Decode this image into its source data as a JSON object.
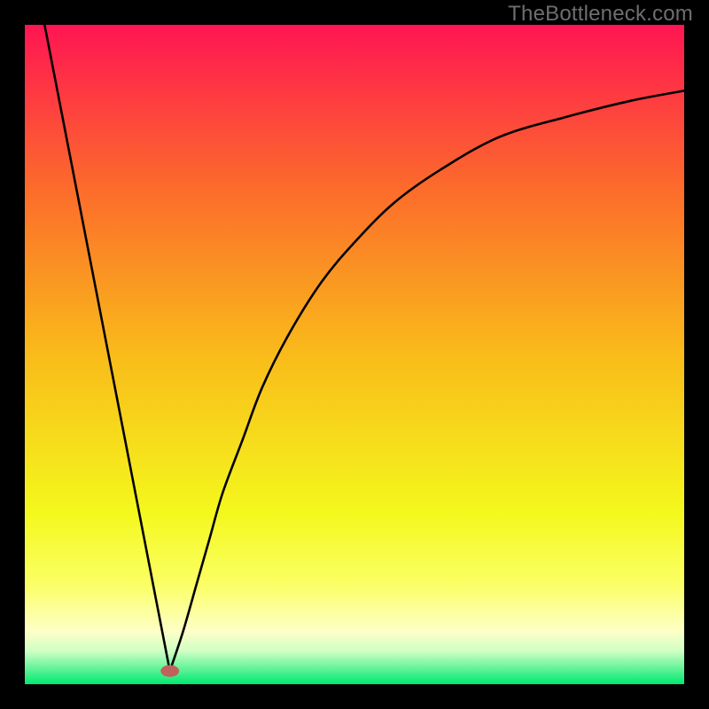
{
  "watermark": "TheBottleneck.com",
  "chart_data": {
    "type": "line",
    "title": "",
    "xlabel": "",
    "ylabel": "",
    "xlim": [
      0,
      100
    ],
    "ylim": [
      0,
      100
    ],
    "grid": false,
    "legend": false,
    "series": [
      {
        "name": "left-branch",
        "x": [
          3,
          22
        ],
        "y": [
          100,
          2
        ]
      },
      {
        "name": "right-branch",
        "x": [
          22,
          24,
          26,
          28,
          30,
          33,
          36,
          40,
          45,
          50,
          56,
          63,
          72,
          82,
          92,
          100
        ],
        "y": [
          2,
          8,
          15,
          22,
          29,
          37,
          45,
          53,
          61,
          67,
          73,
          78,
          83,
          86,
          88.5,
          90
        ]
      }
    ],
    "annotations": [
      {
        "name": "vertex-marker",
        "x": 22,
        "y": 2,
        "shape": "ellipse",
        "rx": 1.4,
        "ry": 0.9,
        "fill": "#c1615c"
      }
    ],
    "background_gradient": {
      "type": "linear-vertical",
      "stops": [
        {
          "offset": 0.0,
          "color": "#ff1552"
        },
        {
          "offset": 0.25,
          "color": "#fc6c2b"
        },
        {
          "offset": 0.5,
          "color": "#f9bb1a"
        },
        {
          "offset": 0.74,
          "color": "#f4f81d"
        },
        {
          "offset": 0.85,
          "color": "#fbff66"
        },
        {
          "offset": 0.92,
          "color": "#fdffc7"
        },
        {
          "offset": 0.95,
          "color": "#cfffc4"
        },
        {
          "offset": 1.0,
          "color": "#00e971"
        }
      ]
    },
    "line_style": {
      "color": "#000000",
      "width": 2.6
    }
  }
}
